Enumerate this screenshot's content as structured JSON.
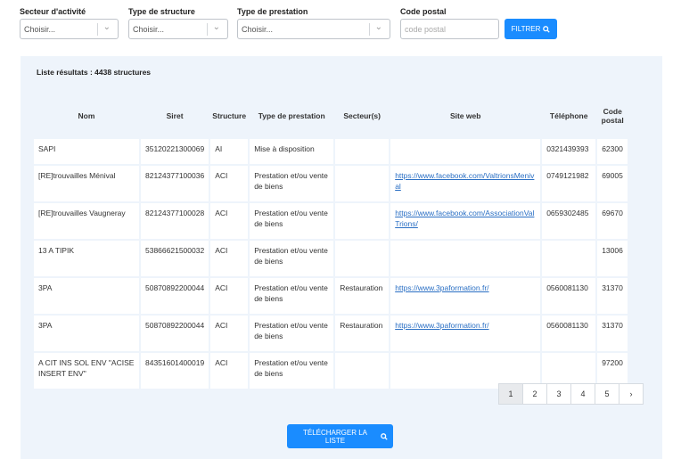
{
  "filters": {
    "secteur": {
      "label": "Secteur d'activité",
      "value": "Choisir..."
    },
    "type_structure": {
      "label": "Type de structure",
      "value": "Choisir..."
    },
    "type_prestation": {
      "label": "Type de prestation",
      "value": "Choisir..."
    },
    "code_postal": {
      "label": "Code postal",
      "placeholder": "code postal"
    },
    "filter_button": "FILTRER"
  },
  "results": {
    "count_label": "Liste résultats : 4438 structures",
    "columns": [
      "Nom",
      "Siret",
      "Structure",
      "Type de prestation",
      "Secteur(s)",
      "Site web",
      "Téléphone",
      "Code postal"
    ],
    "rows": [
      {
        "nom": "SAPI",
        "siret": "35120221300069",
        "structure": "AI",
        "type": "Mise à disposition",
        "secteur": "",
        "site": "",
        "tel": "0321439393",
        "cp": "62300"
      },
      {
        "nom": "[RE]trouvailles Ménival",
        "siret": "82124377100036",
        "structure": "ACI",
        "type": "Prestation et/ou vente de biens",
        "secteur": "",
        "site": "https://www.facebook.com/ValtrionsMenival",
        "tel": "0749121982",
        "cp": "69005"
      },
      {
        "nom": "[RE]trouvailles Vaugneray",
        "siret": "82124377100028",
        "structure": "ACI",
        "type": "Prestation et/ou vente de biens",
        "secteur": "",
        "site": "https://www.facebook.com/AssociationValTrions/",
        "tel": "0659302485",
        "cp": "69670"
      },
      {
        "nom": "13 A TIPIK",
        "siret": "53866621500032",
        "structure": "ACI",
        "type": "Prestation et/ou vente de biens",
        "secteur": "",
        "site": "",
        "tel": "",
        "cp": "13006"
      },
      {
        "nom": "3PA",
        "siret": "50870892200044",
        "structure": "ACI",
        "type": "Prestation et/ou vente de biens",
        "secteur": "Restauration",
        "site": "https://www.3paformation.fr/",
        "tel": "0560081130",
        "cp": "31370"
      },
      {
        "nom": "3PA",
        "siret": "50870892200044",
        "structure": "ACI",
        "type": "Prestation et/ou vente de biens",
        "secteur": "Restauration",
        "site": "https://www.3paformation.fr/",
        "tel": "0560081130",
        "cp": "31370"
      },
      {
        "nom": "A CIT INS SOL ENV \"ACISE INSERT ENV\"",
        "siret": "84351601400019",
        "structure": "ACI",
        "type": "Prestation et/ou vente de biens",
        "secteur": "",
        "site": "",
        "tel": "",
        "cp": "97200"
      }
    ]
  },
  "pagination": {
    "pages": [
      "1",
      "2",
      "3",
      "4",
      "5"
    ],
    "current": "1",
    "next": "›"
  },
  "download_button": "TÉLÉCHARGER LA LISTE",
  "icons": {
    "search": "search-icon",
    "chevron": "chevron-down-icon"
  },
  "colors": {
    "accent": "#1a8cff",
    "panel": "#eef4fb",
    "link": "#2a6fc4"
  }
}
